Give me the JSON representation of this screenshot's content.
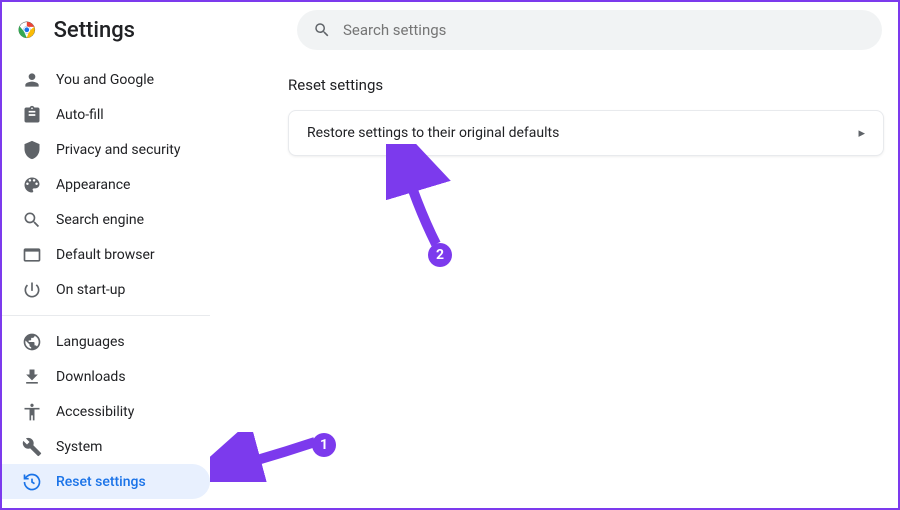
{
  "header": {
    "title": "Settings",
    "search_placeholder": "Search settings"
  },
  "sidebar": {
    "items": [
      {
        "label": "You and Google"
      },
      {
        "label": "Auto-fill"
      },
      {
        "label": "Privacy and security"
      },
      {
        "label": "Appearance"
      },
      {
        "label": "Search engine"
      },
      {
        "label": "Default browser"
      },
      {
        "label": "On start-up"
      }
    ],
    "items2": [
      {
        "label": "Languages"
      },
      {
        "label": "Downloads"
      },
      {
        "label": "Accessibility"
      },
      {
        "label": "System"
      },
      {
        "label": "Reset settings"
      }
    ]
  },
  "main": {
    "section_title": "Reset settings",
    "restore_row": "Restore settings to their original defaults"
  },
  "annotations": {
    "badge1": "1",
    "badge2": "2"
  },
  "colors": {
    "accent": "#7c3aed",
    "link": "#1a73e8"
  }
}
